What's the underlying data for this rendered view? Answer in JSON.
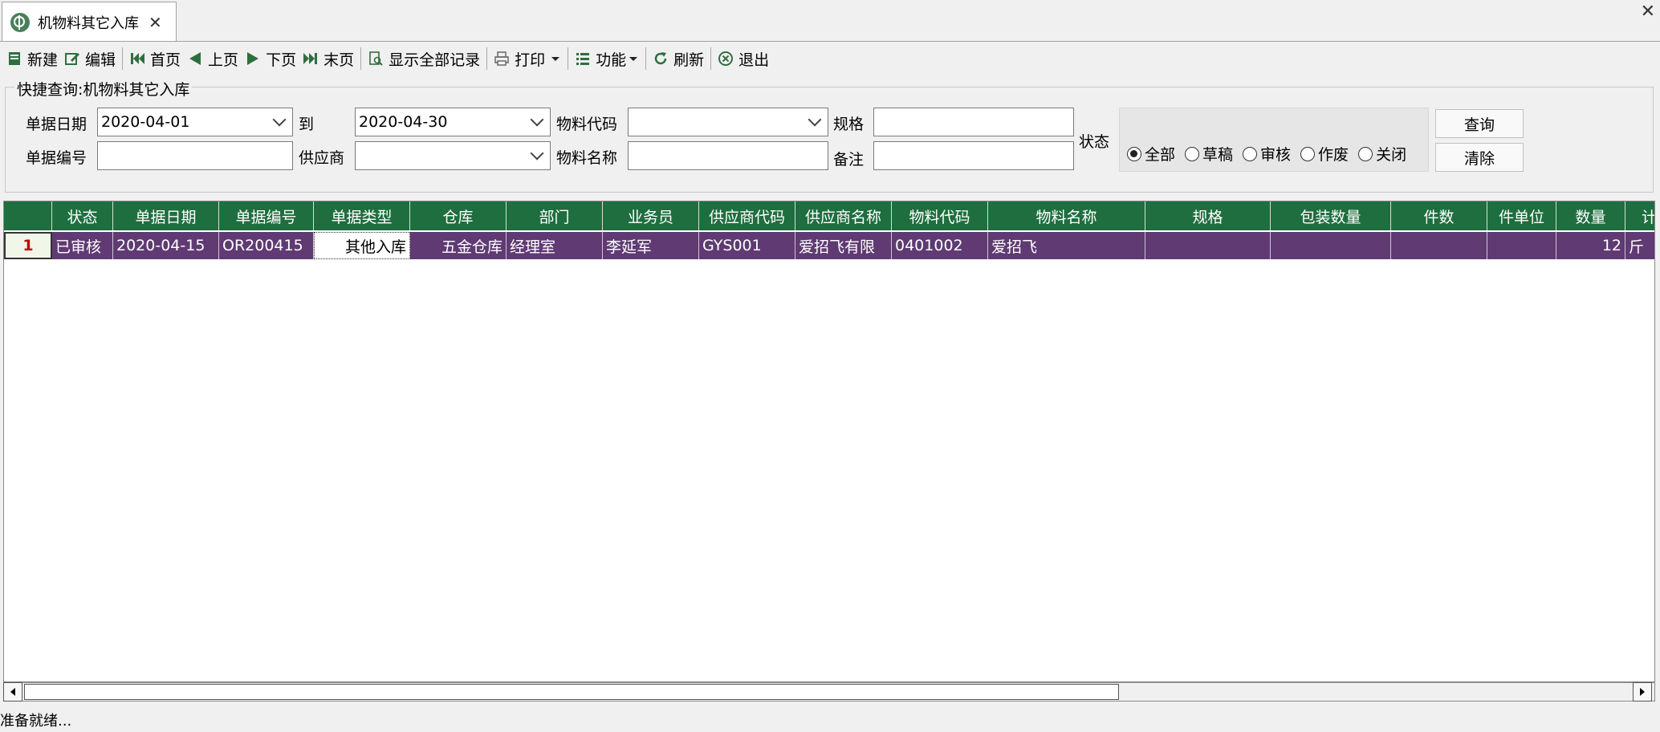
{
  "tab": {
    "title": "机物料其它入库",
    "close": "✕"
  },
  "window": {
    "close": "✕"
  },
  "toolbar": {
    "new": "新建",
    "edit": "编辑",
    "first": "首页",
    "prev": "上页",
    "next": "下页",
    "last": "末页",
    "show_all": "显示全部记录",
    "print": "打印",
    "function": "功能",
    "refresh": "刷新",
    "exit": "退出"
  },
  "query": {
    "title": "快捷查询:机物料其它入库",
    "date_label": "单据日期",
    "date_from": "2020-04-01",
    "to_label": "到",
    "date_to": "2020-04-30",
    "material_code_label": "物料代码",
    "material_code": "",
    "spec_label": "规格",
    "spec": "",
    "doc_no_label": "单据编号",
    "doc_no": "",
    "supplier_label": "供应商",
    "supplier": "",
    "material_name_label": "物料名称",
    "material_name": "",
    "remark_label": "备注",
    "remark": "",
    "status_label": "状态",
    "status_options": [
      "全部",
      "草稿",
      "审核",
      "作废",
      "关闭"
    ],
    "status_selected": "全部",
    "search_button": "查询",
    "clear_button": "清除"
  },
  "grid": {
    "columns": [
      "",
      "状态",
      "单据日期",
      "单据编号",
      "单据类型",
      "仓库",
      "部门",
      "业务员",
      "供应商代码",
      "供应商名称",
      "物料代码",
      "物料名称",
      "规格",
      "包装数量",
      "件数",
      "件单位",
      "数量",
      "计"
    ],
    "rows": [
      [
        "1",
        "已审核",
        "2020-04-15",
        "OR200415",
        "其他入库",
        "五金仓库",
        "经理室",
        "李延军",
        "GYS001",
        "爱招飞有限",
        "0401002",
        "爱招飞",
        "",
        "",
        "",
        "",
        "12",
        "斤"
      ]
    ]
  },
  "statusbar": {
    "text": "准备就绪..."
  },
  "colors": {
    "header_green": "#1f6e3f",
    "row_purple": "#5f3a73"
  }
}
